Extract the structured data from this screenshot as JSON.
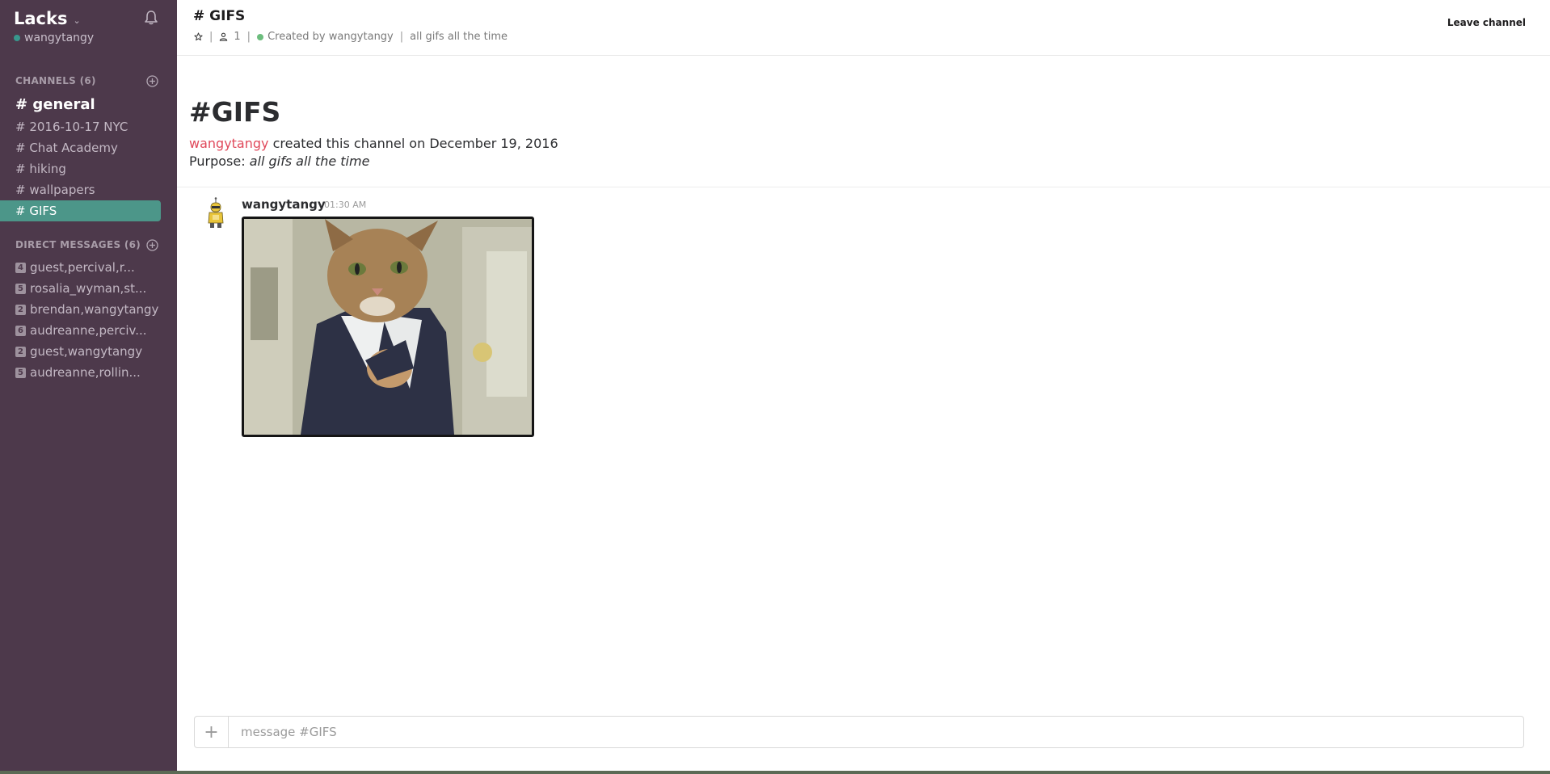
{
  "sidebar": {
    "team_name": "Lacks",
    "user": "wangytangy",
    "channels_header": "CHANNELS (6)",
    "channels": [
      {
        "label": "# general"
      },
      {
        "label": "# 2016-10-17 NYC"
      },
      {
        "label": "# Chat Academy"
      },
      {
        "label": "# hiking"
      },
      {
        "label": "# wallpapers"
      },
      {
        "label": "# GIFS"
      }
    ],
    "dm_header": "DIRECT MESSAGES (6)",
    "dms": [
      {
        "count": "4",
        "label": "guest,percival,r..."
      },
      {
        "count": "5",
        "label": "rosalia_wyman,st..."
      },
      {
        "count": "2",
        "label": "brendan,wangytangy"
      },
      {
        "count": "6",
        "label": "audreanne,perciv..."
      },
      {
        "count": "2",
        "label": "guest,wangytangy"
      },
      {
        "count": "5",
        "label": "audreanne,rollin..."
      }
    ]
  },
  "header": {
    "channel_title": "# GIFS",
    "member_count": "1",
    "created_by": "Created by wangytangy",
    "purpose": "all gifs all the time",
    "leave_label": "Leave channel"
  },
  "intro": {
    "title": "#GIFS",
    "creator": "wangytangy",
    "created_text": "created this channel on December 19, 2016",
    "purpose_label": "Purpose:",
    "purpose_text": "all gifs all the time"
  },
  "messages": [
    {
      "author": "wangytangy",
      "time": "01:30 AM",
      "attachment": "animated GIF of a cat in a suit"
    }
  ],
  "composer": {
    "placeholder": "message #GIFS",
    "add_icon": "plus-icon"
  },
  "colors": {
    "sidebar_bg": "#4d394b",
    "active_channel": "#4c9689",
    "presence": "#38978d",
    "creator_link": "#e0495b"
  }
}
